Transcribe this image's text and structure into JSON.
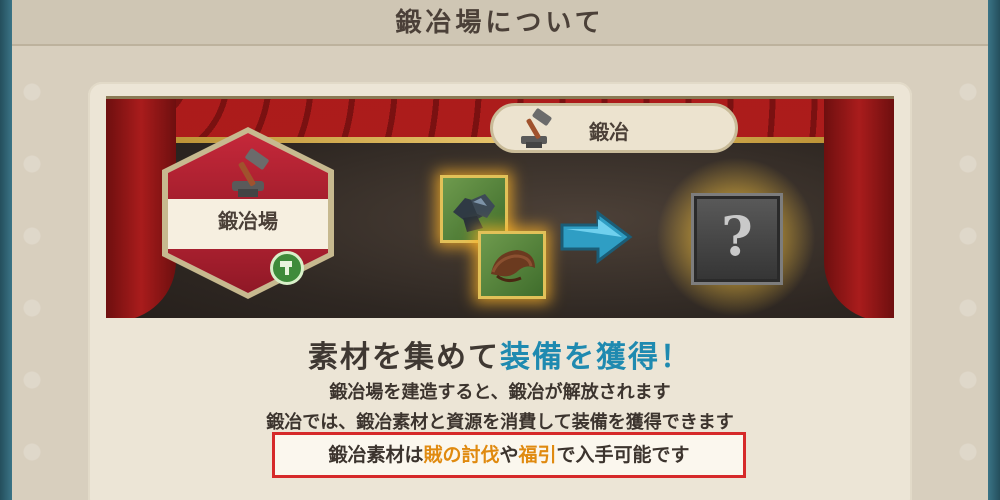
{
  "title": "鍛冶場について",
  "banner": {
    "building_label": "鍛冶場",
    "action_tab_label": "鍛冶",
    "materials": [
      "ore-icon",
      "leather-icon"
    ],
    "result": "?"
  },
  "headline": {
    "part1": "素材を集めて",
    "part2_accent": "装備を獲得！"
  },
  "descriptions": [
    "鍛冶場を建造すると、鍛冶が解放されます",
    "鍛冶では、鍛冶素材と資源を消費して装備を獲得できます"
  ],
  "notice": {
    "prefix": "鍛冶素材は",
    "hl1": "賊の討伐",
    "mid": "や",
    "hl2": "福引",
    "suffix": "で入手可能です"
  },
  "colors": {
    "accent_blue": "#1f8ab0",
    "highlight_orange": "#e08a10",
    "notice_border": "#d62a2a"
  }
}
